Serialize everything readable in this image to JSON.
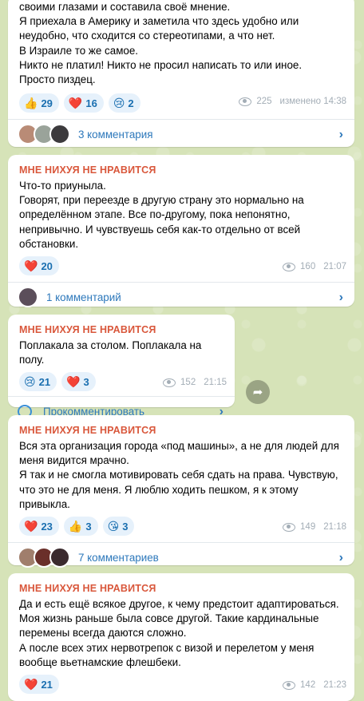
{
  "posts": [
    {
      "text": [
        "своими глазами и составила своё мнение.",
        "Я приехала в Америку и заметила что здесь удобно или неудобно, что сходится со стереотипами, а что нет.",
        "В Израиле то же самое.",
        "Никто не платил! Никто не просил написать то или иное.",
        "Просто пиздец."
      ],
      "reactions": [
        {
          "emoji": "👍",
          "count": "29"
        },
        {
          "emoji": "❤️",
          "count": "16"
        },
        {
          "emoji": "😢",
          "count": "2"
        }
      ],
      "views": "225",
      "time": "изменено 14:38",
      "comments": "3 комментария"
    },
    {
      "channel": "МНЕ НИХУЯ НЕ НРАВИТСЯ",
      "text": [
        "Что-то приуныла.",
        "Говорят, при переезде в другую страну это нормально на определённом этапе. Все по-другому, пока непонятно, непривычно. И чувствуешь себя как-то отдельно от всей обстановки."
      ],
      "reactions": [
        {
          "emoji": "❤️",
          "count": "20"
        }
      ],
      "views": "160",
      "time": "21:07",
      "comments": "1 комментарий"
    },
    {
      "channel": "МНЕ НИХУЯ НЕ НРАВИТСЯ",
      "text": [
        "Поплакала за столом. Поплакала на полу."
      ],
      "reactions": [
        {
          "emoji": "😢",
          "count": "21"
        },
        {
          "emoji": "❤️",
          "count": "3"
        }
      ],
      "views": "152",
      "time": "21:15",
      "comments": "Прокомментировать"
    },
    {
      "channel": "МНЕ НИХУЯ НЕ НРАВИТСЯ",
      "text": [
        "Вся эта организация города «под машины», а не для людей для меня видится мрачно.",
        "Я так и не смогла мотивировать себя сдать на права. Чувствую, что это не для меня. Я люблю ходить пешком, я к этому привыкла."
      ],
      "reactions": [
        {
          "emoji": "❤️",
          "count": "23"
        },
        {
          "emoji": "👍",
          "count": "3"
        },
        {
          "emoji": "😘",
          "count": "3"
        }
      ],
      "views": "149",
      "time": "21:18",
      "comments": "7 комментариев"
    },
    {
      "channel": "МНЕ НИХУЯ НЕ НРАВИТСЯ",
      "text": [
        "Да и есть ещё всякое другое, к чему предстоит адаптироваться.",
        "Моя жизнь раньше была совсе другой. Такие кардинальные перемены всегда даются сложно.",
        "А после всех этих нервотрепок с визой и перелетом у меня вообще вьетнамские флешбеки."
      ],
      "reactions": [
        {
          "emoji": "❤️",
          "count": "21"
        }
      ],
      "views": "142",
      "time": "21:23"
    }
  ],
  "share_icon": "arrow-share-icon",
  "colors": {
    "channel": "#d9573b",
    "link": "#2d78bb",
    "reaction_bg": "#e6f1fb"
  }
}
